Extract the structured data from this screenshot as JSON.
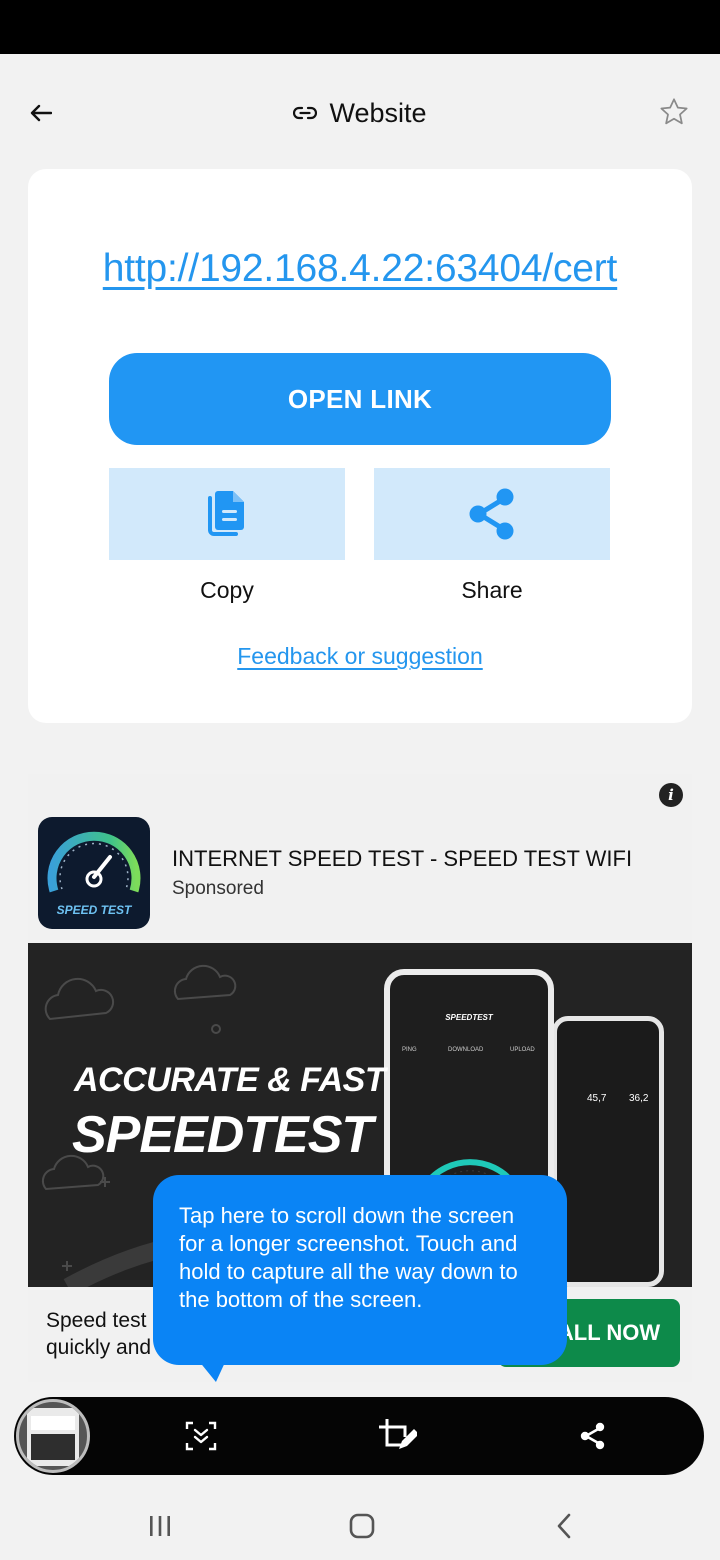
{
  "header": {
    "title": "Website",
    "back_icon": "arrow-left-icon",
    "title_icon": "link-icon",
    "favorite_icon": "star-outline-icon"
  },
  "result": {
    "url": "http://192.168.4.22:63404/cert",
    "open_label": "OPEN LINK",
    "copy_label": "Copy",
    "share_label": "Share",
    "feedback_label": "Feedback or suggestion",
    "accent_color": "#2196f3"
  },
  "ad": {
    "title": "INTERNET SPEED TEST - SPEED TEST WIFI",
    "sponsored": "Sponsored",
    "icon_text": "SPEED TEST",
    "banner_line1": "ACCURATE & FAST",
    "banner_line2": "SPEEDTEST",
    "phone_app_name": "SPEEDTEST",
    "phone_ping": "PING",
    "phone_download": "DOWNLOAD",
    "phone_upload": "UPLOAD",
    "phone_download_value": "45,7",
    "phone_upload_value": "36,2",
    "description_line1": "Speed test",
    "description_line2": "quickly and",
    "cta_label": "ALL NOW",
    "cta_color": "#0d8a4a"
  },
  "tooltip": {
    "text": "Tap here to scroll down the screen for a longer screenshot. Touch and hold to capture all the way down to the bottom of the screen."
  },
  "capture_toolbar": {
    "icons": [
      "scroll-capture-icon",
      "crop-edit-icon",
      "share-icon"
    ]
  },
  "nav": {
    "icons": [
      "recent-apps-icon",
      "home-icon",
      "back-icon"
    ]
  }
}
